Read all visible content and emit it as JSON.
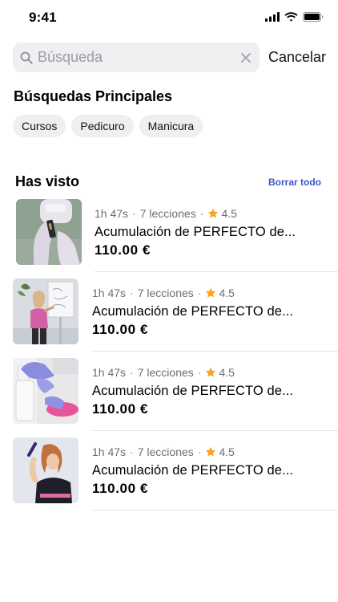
{
  "status_bar": {
    "time": "9:41"
  },
  "search": {
    "placeholder": "Búsqueda",
    "value": "",
    "cancel_label": "Cancelar"
  },
  "top_searches": {
    "title": "Búsquedas Principales",
    "chips": [
      "Cursos",
      "Pedicuro",
      "Manicura"
    ]
  },
  "seen": {
    "title": "Has visto",
    "clear_all_label": "Borrar todo",
    "courses": [
      {
        "duration": "1h 47s",
        "lessons": "7 lecciones",
        "rating": "4.5",
        "title": "Acumulación de PERFECTO de...",
        "price": "110.00 €",
        "thumbnail": "gloved-hands-nail-product"
      },
      {
        "duration": "1h 47s",
        "lessons": "7 lecciones",
        "rating": "4.5",
        "title": "Acumulación de PERFECTO de...",
        "price": "110.00 €",
        "thumbnail": "woman-at-whiteboard"
      },
      {
        "duration": "1h 47s",
        "lessons": "7 lecciones",
        "rating": "4.5",
        "title": "Acumulación de PERFECTO de...",
        "price": "110.00 €",
        "thumbnail": "gloved-hands-spray-bottle"
      },
      {
        "duration": "1h 47s",
        "lessons": "7 lecciones",
        "rating": "4.5",
        "title": "Acumulación de PERFECTO de...",
        "price": "110.00 €",
        "thumbnail": "woman-with-nail-drill"
      }
    ]
  },
  "colors": {
    "accent_link": "#3a56c8",
    "star": "#f5a623",
    "search_background": "#efeff2"
  }
}
